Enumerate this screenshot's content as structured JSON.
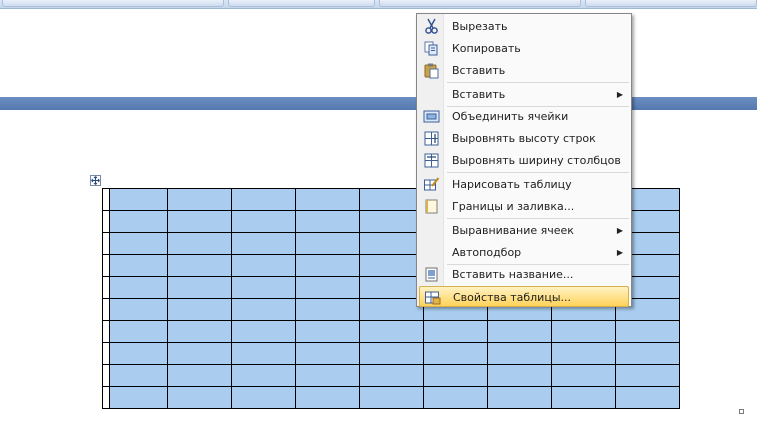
{
  "context_menu": {
    "items": [
      {
        "label": "Вырезать",
        "icon": "scissors-icon",
        "submenu": false
      },
      {
        "label": "Копировать",
        "icon": "copy-icon",
        "submenu": false
      },
      {
        "label": "Вставить",
        "icon": "paste-icon",
        "submenu": false
      },
      {
        "label": "Вставить",
        "icon": "",
        "submenu": true
      },
      {
        "label": "Объединить ячейки",
        "icon": "merge-cells-icon",
        "submenu": false
      },
      {
        "label": "Выровнять высоту строк",
        "icon": "distribute-rows-icon",
        "submenu": false
      },
      {
        "label": "Выровнять ширину столбцов",
        "icon": "distribute-columns-icon",
        "submenu": false
      },
      {
        "label": "Нарисовать таблицу",
        "icon": "draw-table-icon",
        "submenu": false
      },
      {
        "label": "Границы и заливка...",
        "icon": "borders-shading-icon",
        "submenu": false
      },
      {
        "label": "Выравнивание ячеек",
        "icon": "",
        "submenu": true
      },
      {
        "label": "Автоподбор",
        "icon": "",
        "submenu": true
      },
      {
        "label": "Вставить название...",
        "icon": "insert-caption-icon",
        "submenu": false
      },
      {
        "label": "Свойства таблицы...",
        "icon": "table-properties-icon",
        "submenu": false
      }
    ],
    "highlighted_index": 12,
    "submenu_arrow": "▶"
  },
  "table": {
    "rows": 10,
    "columns": 10,
    "cell_fill_color": "#a9ccef"
  },
  "colors": {
    "page_separator": "#5f83b8",
    "menu_highlight": "#ffd35a"
  }
}
